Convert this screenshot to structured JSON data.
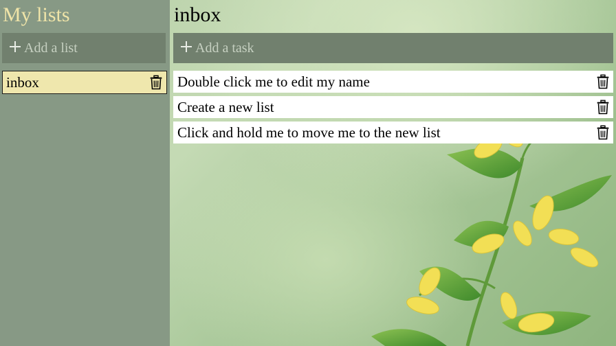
{
  "sidebar": {
    "title": "My lists",
    "add_list_placeholder": "Add a list",
    "lists": [
      {
        "name": "inbox",
        "selected": true
      }
    ]
  },
  "main": {
    "title": "inbox",
    "add_task_placeholder": "Add a task",
    "tasks": [
      {
        "text": "Double click me to edit my name"
      },
      {
        "text": "Create a new list"
      },
      {
        "text": "Click and hold me to move me to the new list"
      }
    ]
  },
  "colors": {
    "sidebar_bg": "#879985",
    "add_row_bg": "#71806e",
    "selected_list_bg": "#efe7ad",
    "title_accent": "#efe4a8",
    "task_bg": "#ffffff"
  },
  "icons": {
    "add": "plus-icon",
    "delete": "trash-icon",
    "background": "yellow-flower-photo"
  }
}
